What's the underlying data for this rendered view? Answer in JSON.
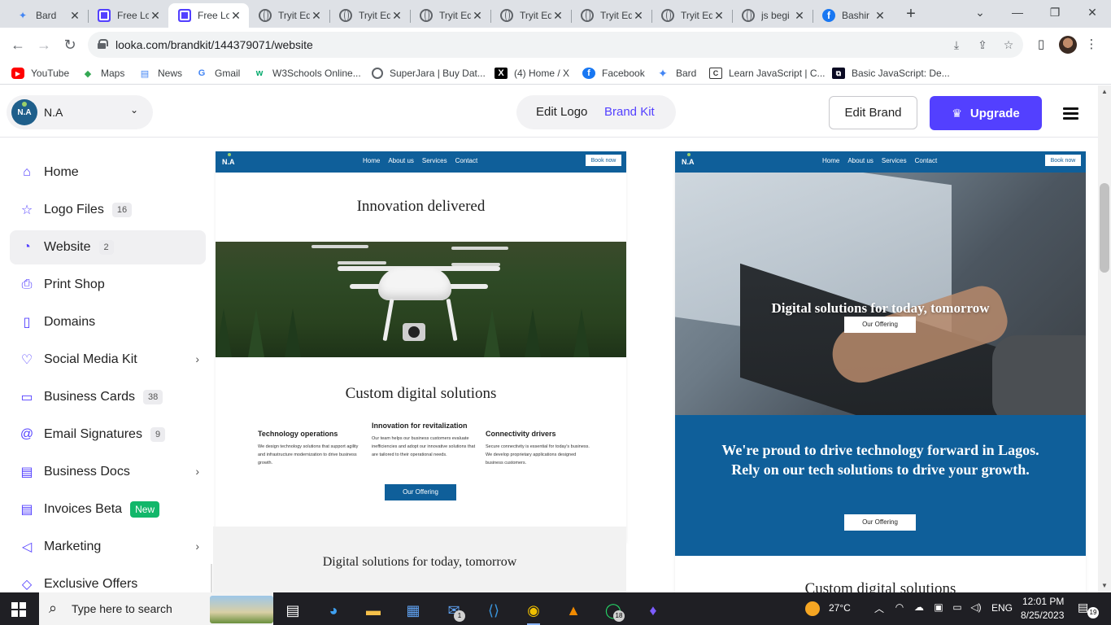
{
  "browser": {
    "tabs": [
      {
        "title": "Bard",
        "icon": "bard-icon"
      },
      {
        "title": "Free Lo",
        "icon": "looka-icon"
      },
      {
        "title": "Free Lo",
        "icon": "looka-icon",
        "active": true
      },
      {
        "title": "Tryit Ed",
        "icon": "globe-icon"
      },
      {
        "title": "Tryit Ed",
        "icon": "globe-icon"
      },
      {
        "title": "Tryit Ed",
        "icon": "globe-icon"
      },
      {
        "title": "Tryit Ed",
        "icon": "globe-icon"
      },
      {
        "title": "Tryit Ed",
        "icon": "globe-icon"
      },
      {
        "title": "Tryit Ed",
        "icon": "globe-icon"
      },
      {
        "title": "js begi",
        "icon": "globe-icon"
      },
      {
        "title": "Bashir",
        "icon": "facebook-icon"
      }
    ],
    "url": "looka.com/brandkit/144379071/website",
    "bookmarks": [
      {
        "label": "YouTube",
        "icon": "youtube-icon"
      },
      {
        "label": "Maps",
        "icon": "maps-icon"
      },
      {
        "label": "News",
        "icon": "news-icon"
      },
      {
        "label": "Gmail",
        "icon": "google-icon"
      },
      {
        "label": "W3Schools Online...",
        "icon": "w3schools-icon"
      },
      {
        "label": "SuperJara | Buy Dat...",
        "icon": "globe-icon"
      },
      {
        "label": "(4) Home / X",
        "icon": "x-icon"
      },
      {
        "label": "Facebook",
        "icon": "facebook-icon"
      },
      {
        "label": "Bard",
        "icon": "bard-icon"
      },
      {
        "label": "Learn JavaScript | C...",
        "icon": "codecademy-icon"
      },
      {
        "label": "Basic JavaScript: De...",
        "icon": "freecodecamp-icon"
      }
    ]
  },
  "header": {
    "brand_logo_text": "N.A",
    "brand_name": "N.A",
    "seg_edit_logo": "Edit Logo",
    "seg_brand_kit": "Brand Kit",
    "edit_brand": "Edit Brand",
    "upgrade": "Upgrade",
    "accent": "#5340ff"
  },
  "sidebar": {
    "items": [
      {
        "label": "Home",
        "icon": "home-icon"
      },
      {
        "label": "Logo Files",
        "icon": "star-icon",
        "count": "16"
      },
      {
        "label": "Website",
        "icon": "website-icon",
        "count": "2",
        "active": true
      },
      {
        "label": "Print Shop",
        "icon": "print-icon"
      },
      {
        "label": "Domains",
        "icon": "bookmark-icon"
      },
      {
        "label": "Social Media Kit",
        "icon": "heart-icon",
        "chevron": true
      },
      {
        "label": "Business Cards",
        "icon": "card-icon",
        "count": "38"
      },
      {
        "label": "Email Signatures",
        "icon": "at-icon",
        "count": "9"
      },
      {
        "label": "Business Docs",
        "icon": "doc-icon",
        "chevron": true
      },
      {
        "label": "Invoices Beta",
        "icon": "invoice-icon",
        "new": "New"
      },
      {
        "label": "Marketing",
        "icon": "megaphone-icon",
        "chevron": true
      },
      {
        "label": "Exclusive Offers",
        "icon": "tag-icon"
      }
    ]
  },
  "preview1": {
    "logo": "N.A",
    "nav": [
      "Home",
      "About us",
      "Services",
      "Contact"
    ],
    "book": "Book now",
    "hero_title": "Innovation delivered",
    "section_title": "Custom digital solutions",
    "columns": [
      {
        "title": "Technology operations",
        "text": "We design technology solutions that support agility and infrastructure modernization to drive business growth."
      },
      {
        "title": "Innovation for revitalization",
        "text": "Our team helps our business customers evaluate inefficiencies and adopt our innovative solutions that are tailored to their operational needs."
      },
      {
        "title": "Connectivity drivers",
        "text": "Secure connectivity is essential for today's business. We develop proprietary applications designed business customers."
      }
    ],
    "button": "Our Offering",
    "band_title": "Digital solutions for today, tomorrow"
  },
  "preview2": {
    "logo": "N.A",
    "nav": [
      "Home",
      "About us",
      "Services",
      "Contact"
    ],
    "book": "Book now",
    "hero_title": "Digital solutions for today, tomorrow",
    "hero_button": "Our Offering",
    "blue_text": "We're proud to drive technology forward in Lagos. Rely on our tech solutions to drive your growth.",
    "blue_button": "Our Offering",
    "bottom_title": "Custom digital solutions",
    "primary_color": "#0f5f9a"
  },
  "taskbar": {
    "search_placeholder": "Type here to search",
    "weather": "27°C",
    "language": "ENG",
    "time": "12:01 PM",
    "date": "8/25/2023",
    "notifications": "19",
    "mail_badge": "1",
    "whatsapp_badge": "18"
  }
}
